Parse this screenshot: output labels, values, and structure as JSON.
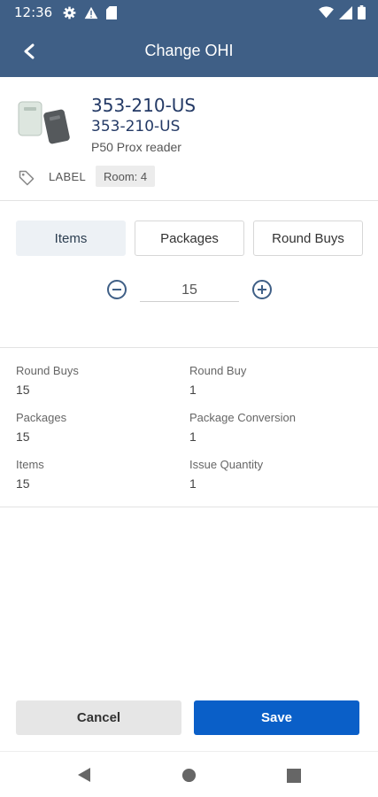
{
  "status_bar": {
    "time": "12:36",
    "icons": [
      "gear-icon",
      "warning-icon",
      "sd-card-icon",
      "wifi-icon",
      "signal-icon",
      "battery-icon"
    ]
  },
  "app_bar": {
    "title": "Change OHI",
    "back_icon": "chevron-left-icon"
  },
  "product": {
    "code": "353-210-US",
    "code_secondary": "353-210-US",
    "description": "P50 Prox reader",
    "label": "LABEL",
    "room": "Room: 4"
  },
  "tabs": [
    {
      "label": "Items",
      "active": true
    },
    {
      "label": "Packages",
      "active": false
    },
    {
      "label": "Round Buys",
      "active": false
    }
  ],
  "stepper": {
    "value": "15"
  },
  "details": {
    "round_buys": {
      "label": "Round Buys",
      "value": "15"
    },
    "round_buy": {
      "label": "Round Buy",
      "value": "1"
    },
    "packages": {
      "label": "Packages",
      "value": "15"
    },
    "package_conversion": {
      "label": "Package Conversion",
      "value": "1"
    },
    "items": {
      "label": "Items",
      "value": "15"
    },
    "issue_quantity": {
      "label": "Issue Quantity",
      "value": "1"
    }
  },
  "actions": {
    "cancel": "Cancel",
    "save": "Save"
  },
  "colors": {
    "header": "#3f5f86",
    "primary": "#0a5fc8",
    "product_text": "#243a66"
  }
}
